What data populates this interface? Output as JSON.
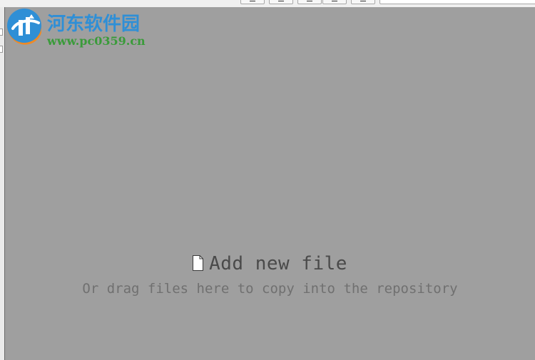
{
  "watermark": {
    "title": "河东软件园",
    "url": "www.pc0359.cn"
  },
  "drop_zone": {
    "add_file_label": "Add new file",
    "drag_hint": "Or drag files here to copy into the repository"
  },
  "colors": {
    "drop_area_bg": "#9f9f9f",
    "add_label": "#4a4a4a",
    "drag_hint": "#707070",
    "watermark_blue": "#2f8fd6",
    "watermark_green": "#3a9b3a",
    "watermark_orange": "#f08a24"
  },
  "icons": {
    "add_file": "file-icon",
    "logo": "watermark-logo-icon"
  }
}
